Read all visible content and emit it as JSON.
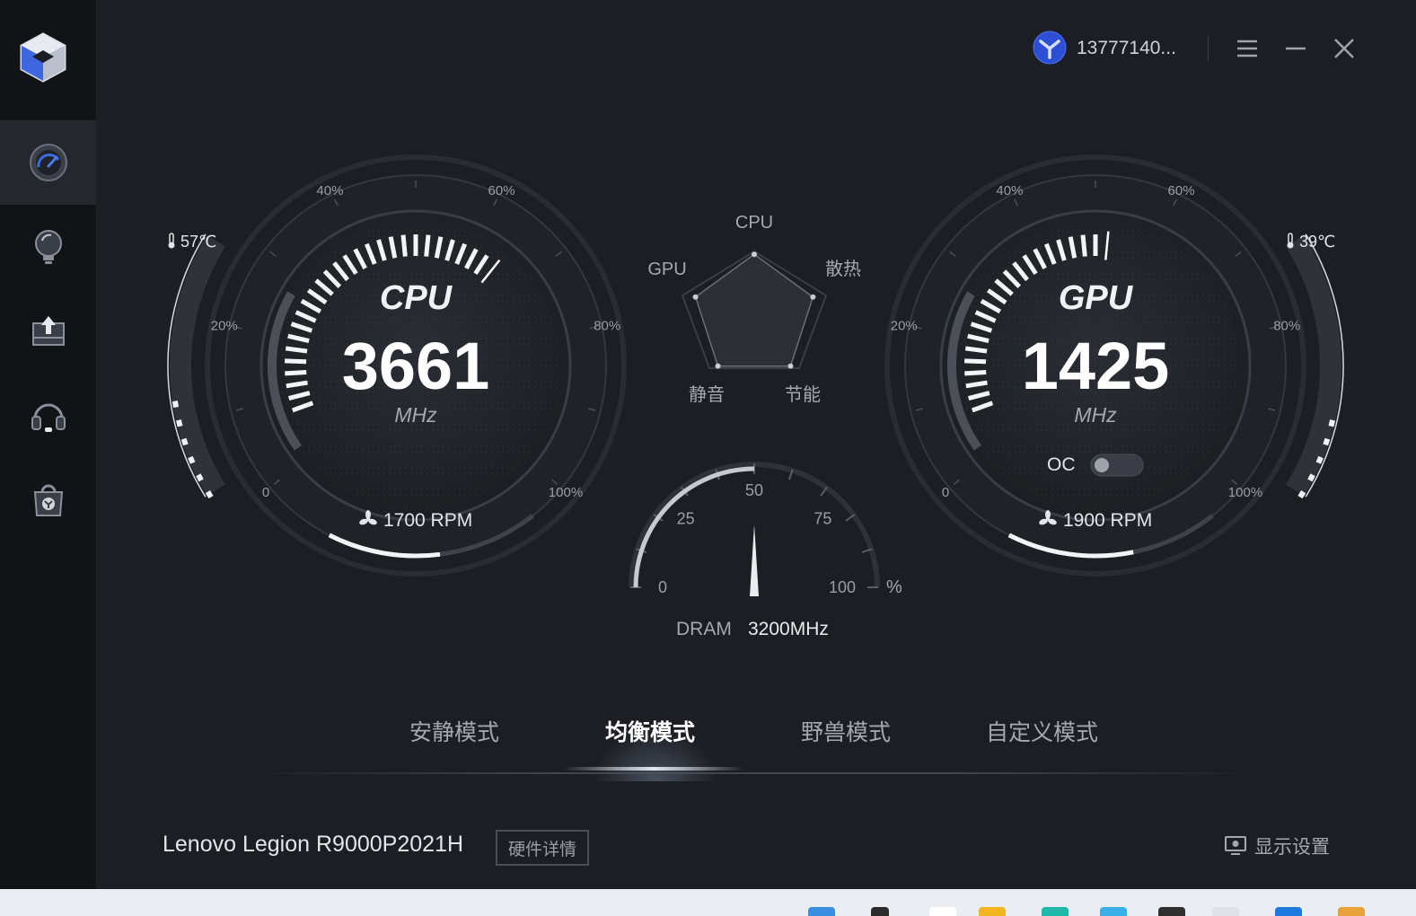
{
  "header": {
    "username": "13777140..."
  },
  "sidebar": {
    "active_index": 0
  },
  "cpu_gauge": {
    "title": "CPU",
    "value": "3661",
    "unit": "MHz",
    "temperature": "57℃",
    "fan": "1700 RPM",
    "ticks": [
      "0",
      "20%",
      "40%",
      "60%",
      "80%",
      "100%"
    ],
    "load_fraction": 0.68,
    "fan_fraction": 0.33,
    "temp_fraction": 0.4
  },
  "gpu_gauge": {
    "title": "GPU",
    "value": "1425",
    "unit": "MHz",
    "temperature": "39℃",
    "fan": "1900 RPM",
    "oc_label": "OC",
    "oc_enabled": false,
    "ticks": [
      "0",
      "20%",
      "40%",
      "60%",
      "80%",
      "100%"
    ],
    "load_fraction": 0.52,
    "fan_fraction": 0.37,
    "temp_fraction": 0.36
  },
  "radar": {
    "labels": {
      "top": "CPU",
      "right": "散热",
      "bottom_right": "节能",
      "bottom_left": "静音",
      "left": "GPU"
    },
    "values": [
      0.8,
      0.8,
      0.8,
      0.8,
      0.8
    ]
  },
  "dram": {
    "label": "DRAM",
    "value": "3200MHz",
    "ticks": [
      "0",
      "25",
      "50",
      "75",
      "100"
    ],
    "unit": "%",
    "usage_percent": 50
  },
  "modes": {
    "items": [
      "安静模式",
      "均衡模式",
      "野兽模式",
      "自定义模式"
    ],
    "active": 1
  },
  "footer": {
    "device": "Lenovo Legion R9000P2021H",
    "hw_detail": "硬件详情",
    "display_settings": "显示设置"
  },
  "colors": {
    "bg": "#1c1e24",
    "sidebar": "#121317",
    "accent": "#ffffff",
    "avatar_blue": "#2d4fd6"
  }
}
